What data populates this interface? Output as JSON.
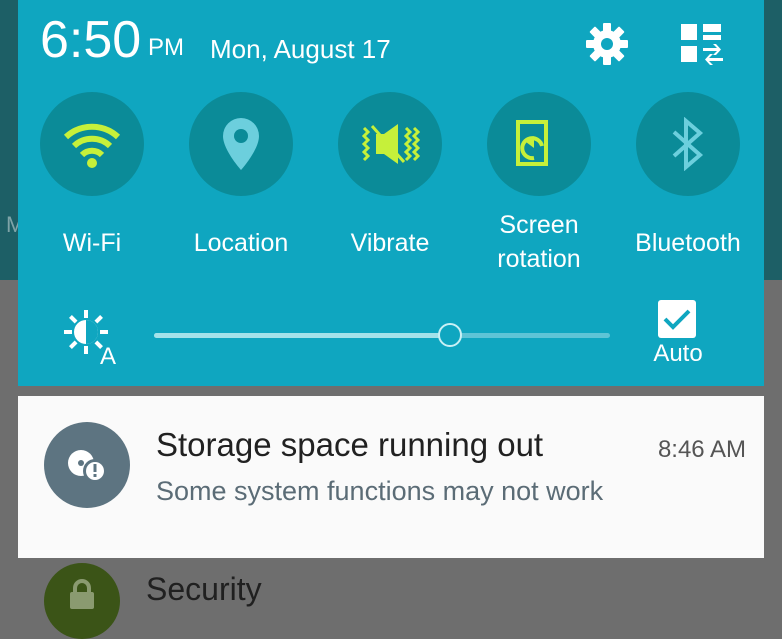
{
  "status": {
    "time": "6:50",
    "ampm": "PM",
    "date": "Mon, August 17"
  },
  "header_icons": [
    "gear-icon",
    "quick-settings-grid-icon"
  ],
  "toggles": [
    {
      "label": "Wi-Fi",
      "icon": "wifi-icon",
      "state": "on"
    },
    {
      "label": "Location",
      "icon": "location-pin-icon",
      "state": "off"
    },
    {
      "label": "Vibrate",
      "icon": "vibrate-icon",
      "state": "on"
    },
    {
      "label": "Screen\nrotation",
      "icon": "screen-rotation-icon",
      "state": "on"
    },
    {
      "label": "Bluetooth",
      "icon": "bluetooth-icon",
      "state": "off"
    }
  ],
  "brightness": {
    "level": 0.65,
    "auto_label": "Auto",
    "auto_checked": true
  },
  "notification": {
    "title": "Storage space running out",
    "time": "8:46 AM",
    "text": "Some system functions may not work",
    "icon": "storage-warning-icon"
  },
  "background": {
    "partial_letter": "M",
    "partial_item_label": "Security"
  },
  "colors": {
    "panel": "#0fa6c0",
    "active_icon": "#c6f03a",
    "inactive_icon": "#6ccfdd",
    "toggle_circle": "#0b8b98"
  }
}
